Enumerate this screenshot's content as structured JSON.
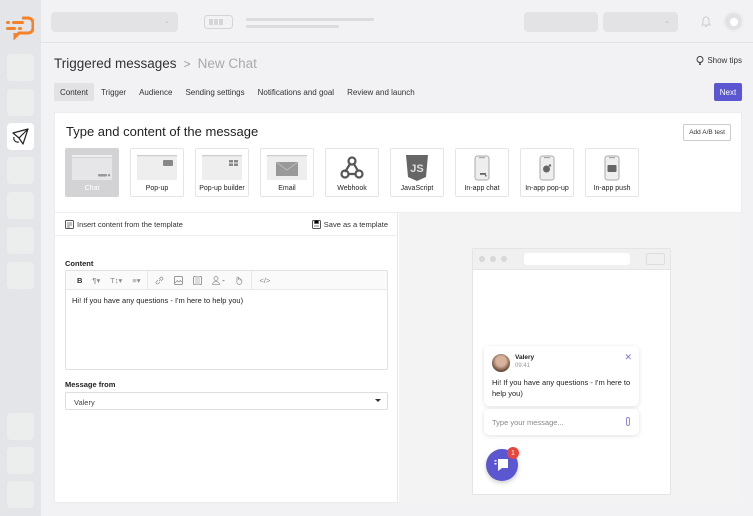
{
  "app": {
    "brand_color": "#f5822a",
    "accent_color": "#5b57d1"
  },
  "breadcrumb": {
    "parent": "Triggered messages",
    "separator": ">",
    "current": "New Chat"
  },
  "show_tips": "Show tips",
  "tabs": [
    {
      "label": "Content",
      "active": true
    },
    {
      "label": "Trigger",
      "active": false
    },
    {
      "label": "Audience",
      "active": false
    },
    {
      "label": "Sending settings",
      "active": false
    },
    {
      "label": "Notifications and goal",
      "active": false
    },
    {
      "label": "Review and launch",
      "active": false
    }
  ],
  "next_button": "Next",
  "section": {
    "title": "Type and content of the message",
    "ab_test_button": "Add A/B test"
  },
  "message_types": [
    {
      "label": "Chat",
      "icon": "chat-window-icon",
      "active": true
    },
    {
      "label": "Pop-up",
      "icon": "popup-window-icon"
    },
    {
      "label": "Pop-up builder",
      "icon": "popup-builder-icon"
    },
    {
      "label": "Email",
      "icon": "envelope-icon"
    },
    {
      "label": "Webhook",
      "icon": "webhook-icon"
    },
    {
      "label": "JavaScript",
      "icon": "javascript-icon"
    },
    {
      "label": "In-app chat",
      "icon": "phone-chat-icon"
    },
    {
      "label": "In-app pop-up",
      "icon": "phone-popup-icon"
    },
    {
      "label": "In-app push",
      "icon": "phone-push-icon"
    }
  ],
  "template_bar": {
    "insert": "Insert content from the template",
    "save": "Save as a template"
  },
  "editor": {
    "label": "Content",
    "toolbar": {
      "bold": "B",
      "paragraph": "¶▾",
      "text_size": "T↕▾",
      "align": "≡▾",
      "code": "</>"
    },
    "text": "Hi! If you have any questions - I'm here to help you)"
  },
  "message_from": {
    "label": "Message from",
    "value": "Valery"
  },
  "preview": {
    "sender_name": "Valery",
    "time": "09:41",
    "message": "Hi! If you have any questions - I'm here to help you)",
    "input_placeholder": "Type your message...",
    "unread_count": "1"
  }
}
